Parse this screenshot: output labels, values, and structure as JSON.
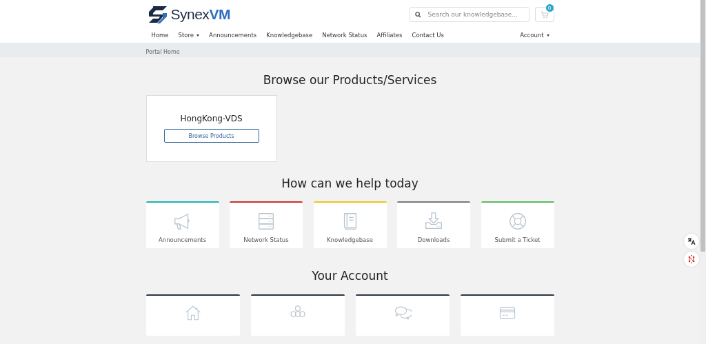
{
  "logo": {
    "text_main": "Synex",
    "text_accent": "VM"
  },
  "search": {
    "placeholder": "Search our knowledgebase..."
  },
  "cart": {
    "count": "0"
  },
  "nav": [
    {
      "label": "Home",
      "dropdown": false
    },
    {
      "label": "Store",
      "dropdown": true
    },
    {
      "label": "Announcements",
      "dropdown": false
    },
    {
      "label": "Knowledgebase",
      "dropdown": false
    },
    {
      "label": "Network Status",
      "dropdown": false
    },
    {
      "label": "Affiliates",
      "dropdown": false
    },
    {
      "label": "Contact Us",
      "dropdown": false
    }
  ],
  "account_menu": {
    "label": "Account",
    "dropdown": true
  },
  "breadcrumb": [
    "Portal Home"
  ],
  "products": {
    "heading": "Browse our Products/Services",
    "items": [
      {
        "name": "HongKong-VDS",
        "button": "Browse Products"
      }
    ]
  },
  "help": {
    "heading": "How can we help today",
    "items": [
      {
        "kind": "megaphone",
        "label": "Announcements",
        "color": "#1ab2b2"
      },
      {
        "kind": "server",
        "label": "Network Status",
        "color": "#c9302c"
      },
      {
        "kind": "book",
        "label": "Knowledgebase",
        "color": "#f0c419"
      },
      {
        "kind": "download",
        "label": "Downloads",
        "color": "#777777"
      },
      {
        "kind": "lifebuoy",
        "label": "Submit a Ticket",
        "color": "#5cb85c"
      }
    ]
  },
  "account": {
    "heading": "Your Account",
    "items": [
      {
        "kind": "home"
      },
      {
        "kind": "cubes"
      },
      {
        "kind": "chat"
      },
      {
        "kind": "card"
      }
    ]
  }
}
